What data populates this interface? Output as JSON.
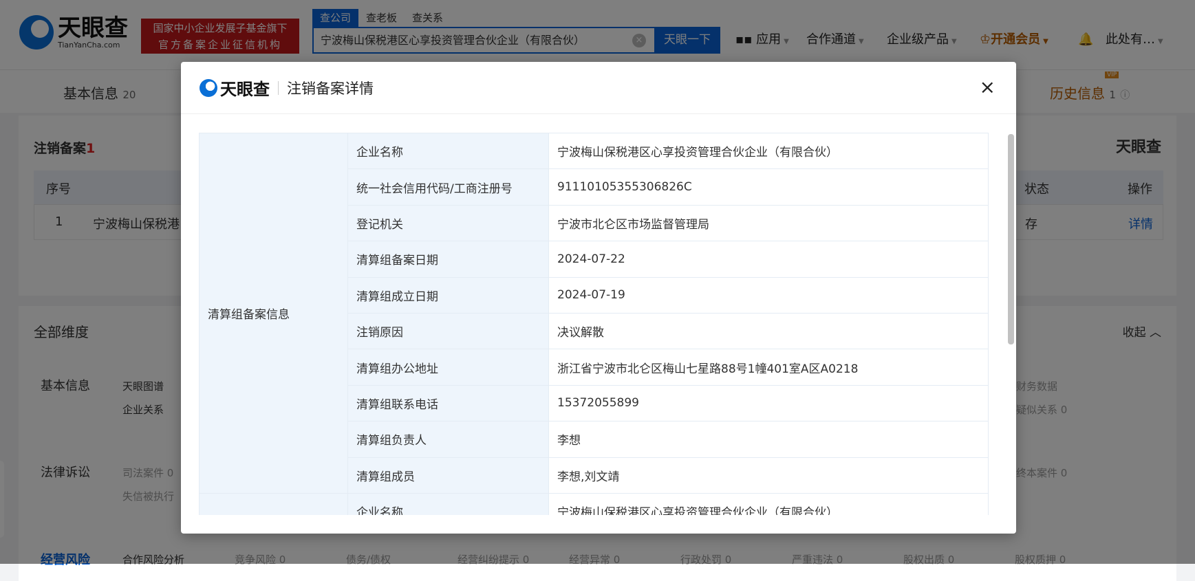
{
  "header": {
    "logo_text": "天眼查",
    "logo_domain": "TianYanCha.com",
    "badge_line1": "国家中小企业发展子基金旗下",
    "badge_line2": "官方备案企业征信机构",
    "search_tabs": [
      "查公司",
      "查老板",
      "查关系"
    ],
    "search_value": "宁波梅山保税港区心享投资管理合伙企业（有限合伙）",
    "clear_icon": "×",
    "search_button": "天眼一下",
    "nav": {
      "apps": "应用",
      "partner": "合作通道",
      "enterprise": "企业级产品",
      "vip": "开通会员",
      "more": "此处有…"
    }
  },
  "page": {
    "tab_basic": "基本信息",
    "tab_basic_count": "20",
    "tab_history": "历史信息",
    "tab_history_count": "1",
    "vip_tag": "VIP",
    "section_title": "注销备案",
    "section_count": "1",
    "brand": "天眼查",
    "table_headers": [
      "序号",
      "状态",
      "操作"
    ],
    "row": {
      "index": "1",
      "name": "宁波梅山保税港",
      "status": "存",
      "action": "详情"
    },
    "dims_title": "全部维度",
    "collapse": "收起",
    "dims": [
      {
        "label": "基本信息",
        "items": [
          "天眼图谱",
          "企业关系",
          "财务数据",
          "疑似关系 0"
        ]
      },
      {
        "label": "法律诉讼",
        "items": [
          "司法案件 0",
          "失信被执行",
          "终本案件 0"
        ]
      },
      {
        "label": "经营风险",
        "items": [
          "合作风险分析",
          "竞争风险 0",
          "债务/债权",
          "经营纠纷提示 0",
          "经营异常 0",
          "行政处罚 0",
          "严重违法 0",
          "股权出质 0",
          "股权质押 0"
        ]
      }
    ]
  },
  "modal": {
    "logo": "天眼查",
    "title": "注销备案详情",
    "close": "×",
    "group_label": "清算组备案信息",
    "rows": [
      [
        "企业名称",
        "宁波梅山保税港区心享投资管理合伙企业（有限合伙）"
      ],
      [
        "统一社会信用代码/工商注册号",
        "91110105355306826C"
      ],
      [
        "登记机关",
        "宁波市北仑区市场监督管理局"
      ],
      [
        "清算组备案日期",
        "2024-07-22"
      ],
      [
        "清算组成立日期",
        "2024-07-19"
      ],
      [
        "注销原因",
        "决议解散"
      ],
      [
        "清算组办公地址",
        "浙江省宁波市北仑区梅山七星路88号1幢401室A区A0218"
      ],
      [
        "清算组联系电话",
        "15372055899"
      ],
      [
        "清算组负责人",
        "李想"
      ],
      [
        "清算组成员",
        "李想,刘文靖"
      ]
    ],
    "next_row": [
      "企业名称",
      "宁波梅山保税港区心享投资管理合伙企业（有限合伙）"
    ]
  }
}
